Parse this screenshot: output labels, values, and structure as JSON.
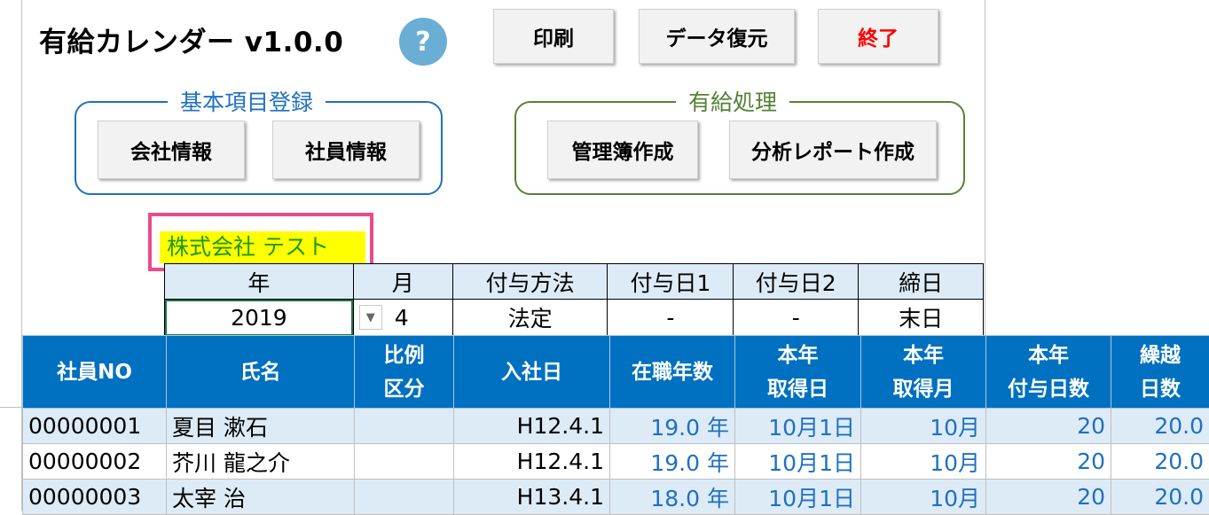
{
  "app": {
    "title": "有給カレンダー v1.0.0",
    "help_label": "?"
  },
  "toolbar": {
    "print_label": "印刷",
    "restore_label": "データ復元",
    "exit_label": "終了",
    "exit_color": "#ff0000"
  },
  "basic_group": {
    "label": "基本項目登録",
    "company_btn": "会社情報",
    "employee_btn": "社員情報",
    "color": "#1f70c1"
  },
  "leave_group": {
    "label": "有給処理",
    "ledger_btn": "管理簿作成",
    "report_btn": "分析レポート作成",
    "color": "#548235"
  },
  "company": {
    "name": "株式会社 テスト"
  },
  "params": {
    "headers": [
      "年",
      "月",
      "付与方法",
      "付与日1",
      "付与日2",
      "締日"
    ],
    "values": [
      "2019",
      "4",
      "法定",
      "-",
      "-",
      "末日"
    ]
  },
  "table": {
    "headers": {
      "no": "社員NO",
      "name": "氏名",
      "ratio": [
        "比例",
        "区分"
      ],
      "hire": "入社日",
      "years": "在職年数",
      "got_date": [
        "本年",
        "取得日"
      ],
      "got_month": [
        "本年",
        "取得月"
      ],
      "grant": [
        "本年",
        "付与日数"
      ],
      "carry": [
        "繰越",
        "日数"
      ]
    },
    "rows": [
      {
        "no": "00000001",
        "name": "夏目 漱石",
        "ratio": "",
        "hire": "H12.4.1",
        "years": "19.0 年",
        "got_date": "10月1日",
        "got_month": "10月",
        "grant": "20",
        "carry": "20.0"
      },
      {
        "no": "00000002",
        "name": "芥川 龍之介",
        "ratio": "",
        "hire": "H12.4.1",
        "years": "19.0 年",
        "got_date": "10月1日",
        "got_month": "10月",
        "grant": "20",
        "carry": "20.0"
      },
      {
        "no": "00000003",
        "name": "太宰 治",
        "ratio": "",
        "hire": "H13.4.1",
        "years": "18.0 年",
        "got_date": "10月1日",
        "got_month": "10月",
        "grant": "20",
        "carry": "20.0"
      }
    ]
  }
}
